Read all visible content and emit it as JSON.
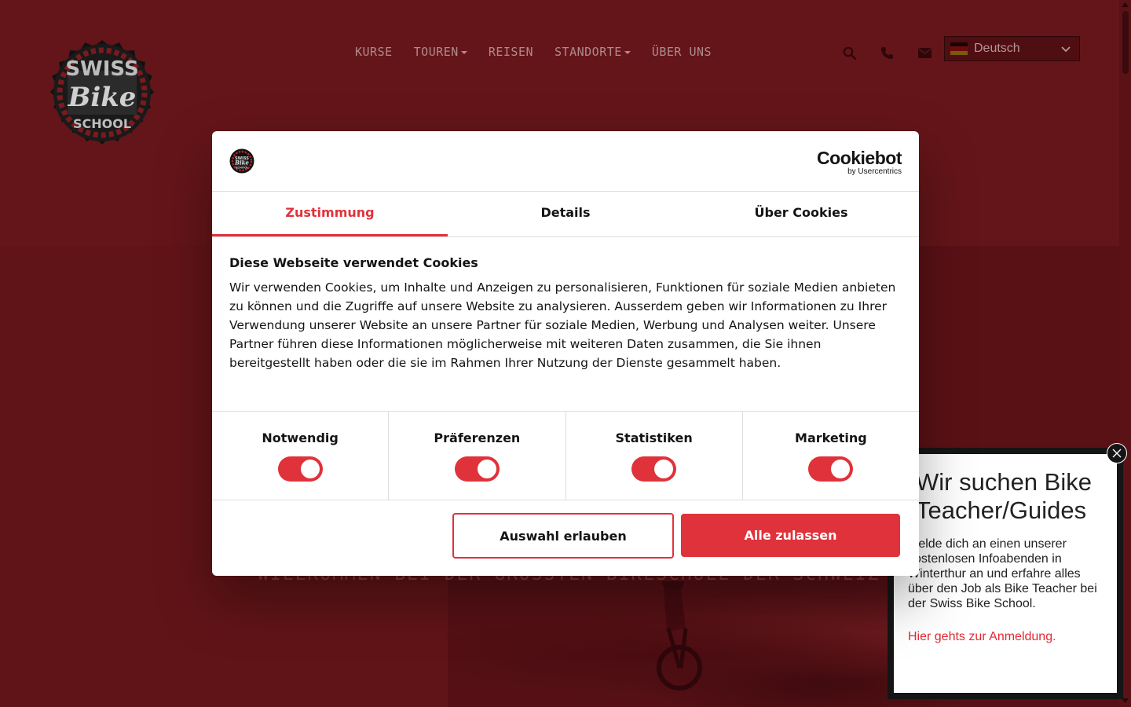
{
  "header": {
    "logo": {
      "line1": "SWISS",
      "line2": "Bike",
      "line3": "SCHOOL"
    },
    "nav": [
      {
        "label": "KURSE",
        "dropdown": false
      },
      {
        "label": "TOUREN",
        "dropdown": true
      },
      {
        "label": "REISEN",
        "dropdown": false
      },
      {
        "label": "STANDORTE",
        "dropdown": true
      },
      {
        "label": "ÜBER UNS",
        "dropdown": false
      }
    ],
    "icons": [
      "search-icon",
      "phone-icon",
      "envelope-icon"
    ],
    "language": {
      "label": "Deutsch",
      "flag": "german-flag"
    }
  },
  "hero": {
    "tagline": "WILLKOMMEN BEI DER GRÖSSTEN BIKESCHULE DER SCHWEIZ"
  },
  "cookie_dialog": {
    "brand_name": "Cookiebot",
    "brand_sub": "by Usercentrics",
    "tabs": [
      {
        "label": "Zustimmung",
        "active": true
      },
      {
        "label": "Details",
        "active": false
      },
      {
        "label": "Über Cookies",
        "active": false
      }
    ],
    "title": "Diese Webseite verwendet Cookies",
    "text": "Wir verwenden Cookies, um Inhalte und Anzeigen zu personalisieren, Funktionen für soziale Medien anbieten zu können und die Zugriffe auf unsere Website zu analysieren. Ausserdem geben wir Informationen zu Ihrer Verwendung unserer Website an unsere Partner für soziale Medien, Werbung und Analysen weiter. Unsere Partner führen diese Informationen möglicherweise mit weiteren Daten zusammen, die Sie ihnen bereitgestellt haben oder die sie im Rahmen Ihrer Nutzung der Dienste gesammelt haben.",
    "toggles": [
      {
        "label": "Notwendig",
        "checked": true
      },
      {
        "label": "Präferenzen",
        "checked": true
      },
      {
        "label": "Statistiken",
        "checked": true
      },
      {
        "label": "Marketing",
        "checked": true
      }
    ],
    "btn_select": "Auswahl erlauben",
    "btn_all": "Alle zulassen",
    "accent_color": "#e0323a"
  },
  "popup": {
    "title": "Wir suchen Bike Teacher/Guides",
    "text": "Melde dich an einen unserer kostenlosen Infoabenden in Winterthur an und erfahre alles über den Job als Bike Teacher bei der Swiss Bike School.",
    "link": "Hier gehts zur Anmeldung."
  },
  "colors": {
    "page_overlay": "#611418",
    "accent": "#e0323a"
  }
}
